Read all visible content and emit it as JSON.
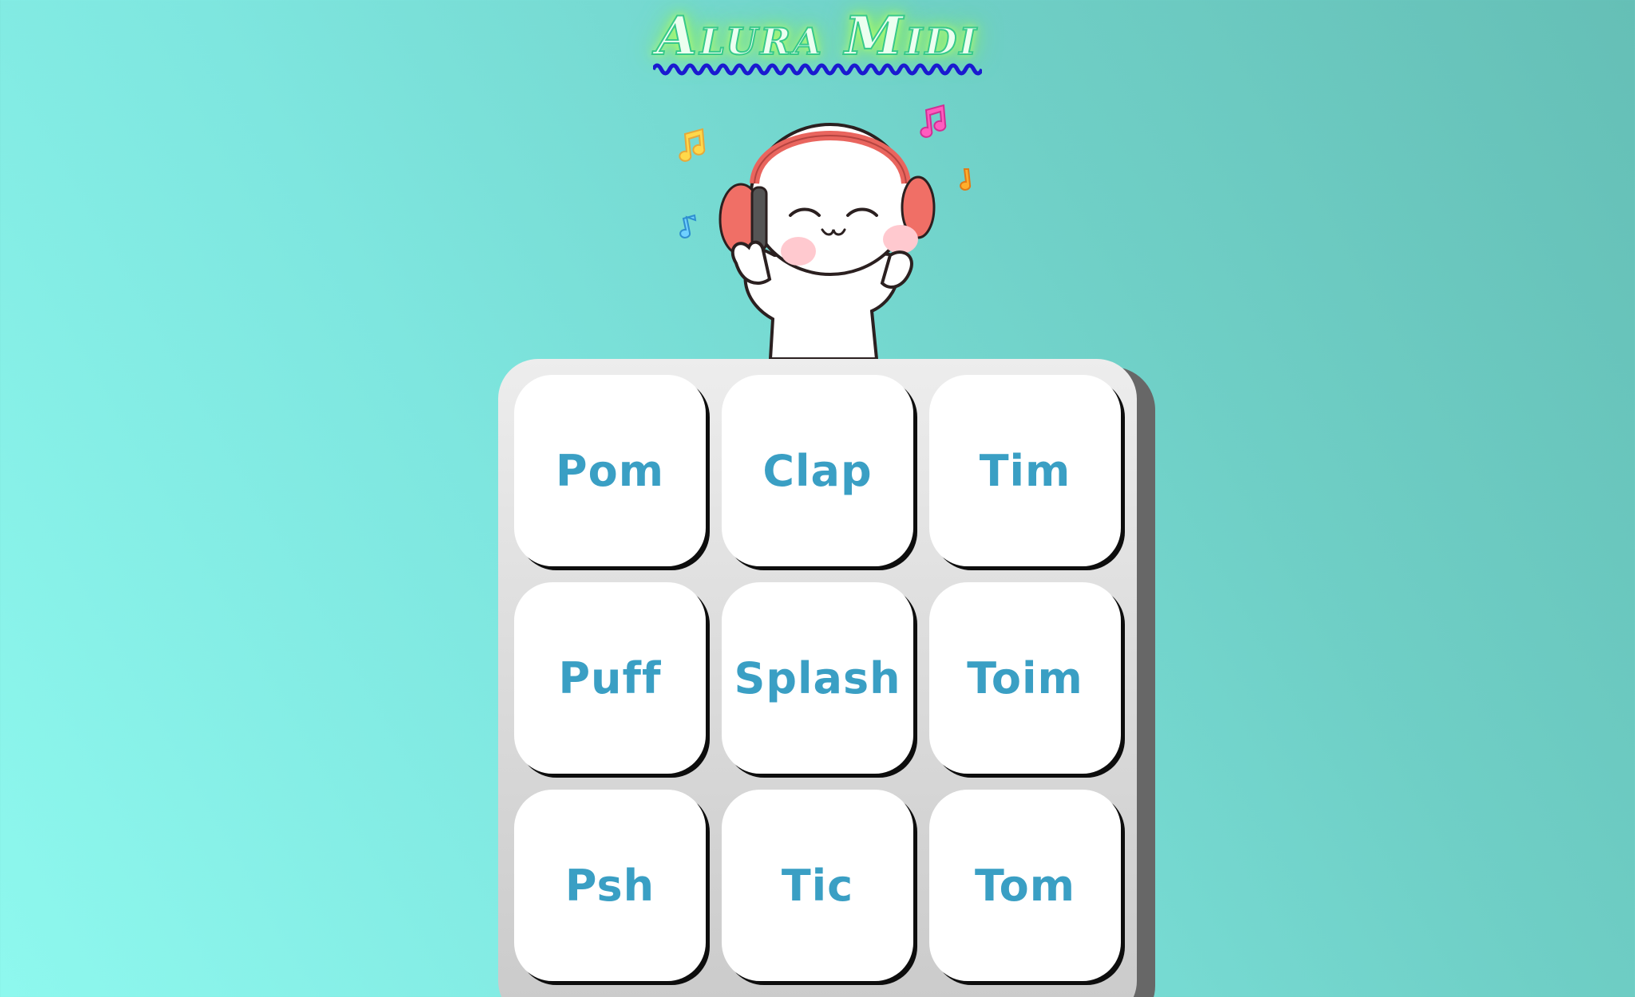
{
  "app": {
    "title": "Alura Midi"
  },
  "colors": {
    "pad_text": "#3a9fc4",
    "pad_bg": "#ffffff",
    "keypad_bg": "#dedede",
    "title_glow": "#97f467",
    "title_wave": "#1a1ad0"
  },
  "mascot": {
    "icon": "headphones-mascot-icon"
  },
  "pads": [
    {
      "label": "Pom"
    },
    {
      "label": "Clap"
    },
    {
      "label": "Tim"
    },
    {
      "label": "Puff"
    },
    {
      "label": "Splash"
    },
    {
      "label": "Toim"
    },
    {
      "label": "Psh"
    },
    {
      "label": "Tic"
    },
    {
      "label": "Tom"
    }
  ]
}
